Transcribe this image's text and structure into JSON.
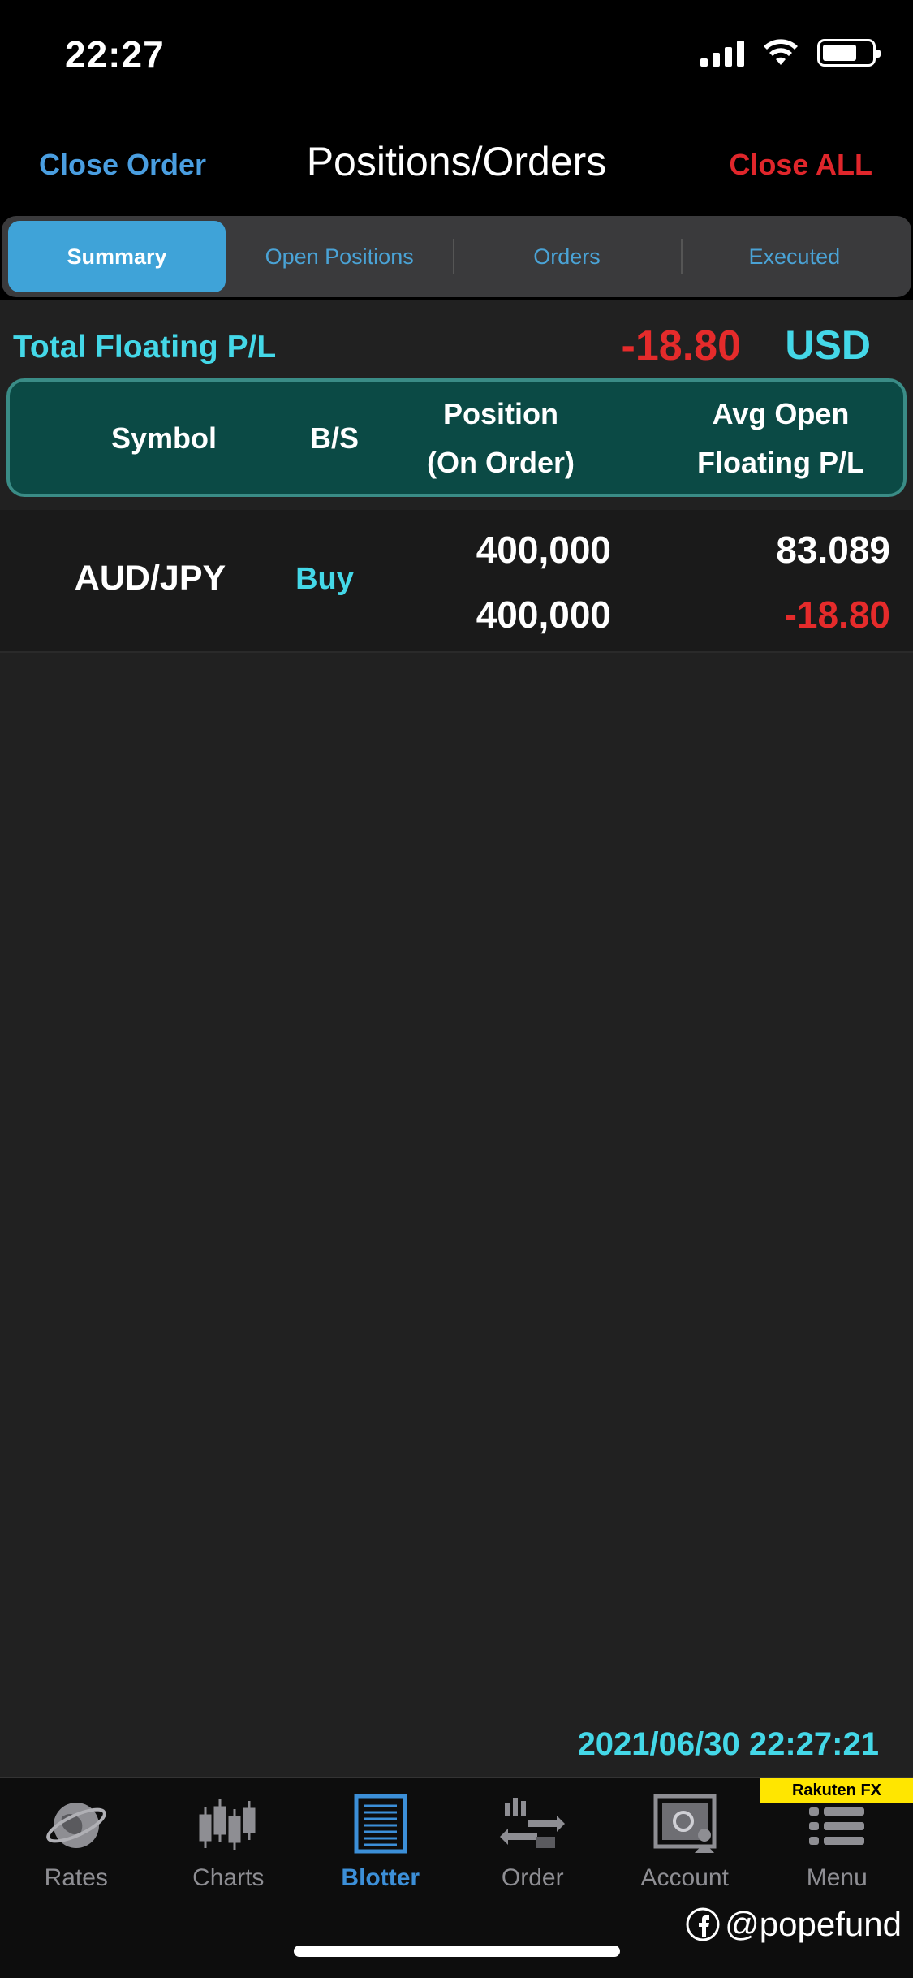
{
  "status_bar": {
    "time": "22:27"
  },
  "nav": {
    "left_action": "Close Order",
    "title": "Positions/Orders",
    "right_action": "Close ALL"
  },
  "segments": [
    {
      "label": "Summary",
      "active": true
    },
    {
      "label": "Open Positions",
      "active": false
    },
    {
      "label": "Orders",
      "active": false
    },
    {
      "label": "Executed",
      "active": false
    }
  ],
  "total": {
    "label": "Total Floating P/L",
    "value": "-18.80",
    "currency": "USD"
  },
  "table": {
    "headers": {
      "symbol": "Symbol",
      "bs": "B/S",
      "position_line1": "Position",
      "position_line2": "(On Order)",
      "avg_line1": "Avg Open",
      "avg_line2": "Floating P/L"
    },
    "rows": [
      {
        "symbol": "AUD/JPY",
        "bs": "Buy",
        "position": "400,000",
        "on_order": "400,000",
        "avg_open": "83.089",
        "floating_pl": "-18.80"
      }
    ]
  },
  "timestamp": "2021/06/30 22:27:21",
  "brand": "Rakuten FX",
  "tab_bar": [
    {
      "label": "Rates",
      "icon": "globe-icon",
      "active": false
    },
    {
      "label": "Charts",
      "icon": "candlestick-icon",
      "active": false
    },
    {
      "label": "Blotter",
      "icon": "blotter-icon",
      "active": true
    },
    {
      "label": "Order",
      "icon": "order-icon",
      "active": false
    },
    {
      "label": "Account",
      "icon": "safe-icon",
      "active": false
    },
    {
      "label": "Menu",
      "icon": "menu-icon",
      "active": false
    }
  ],
  "watermark": "@popefund",
  "colors": {
    "accent_blue": "#3fa3d8",
    "cyan": "#44d8e8",
    "red": "#e52b2b",
    "header_teal": "#0b4a45"
  }
}
